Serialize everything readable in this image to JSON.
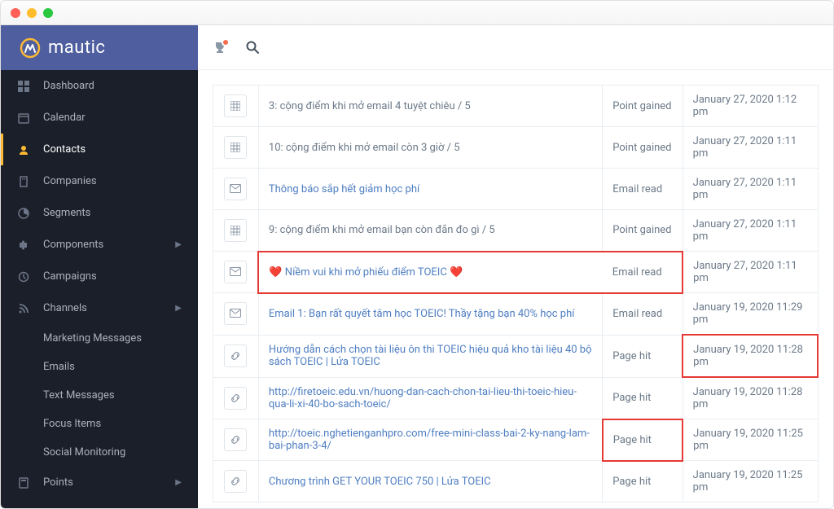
{
  "brand": {
    "name": "mautic"
  },
  "nav": {
    "items": [
      {
        "label": "Dashboard"
      },
      {
        "label": "Calendar"
      },
      {
        "label": "Contacts"
      },
      {
        "label": "Companies"
      },
      {
        "label": "Segments"
      },
      {
        "label": "Components"
      },
      {
        "label": "Campaigns"
      },
      {
        "label": "Channels"
      },
      {
        "label": "Points"
      }
    ],
    "channels_sub": [
      {
        "label": "Marketing Messages"
      },
      {
        "label": "Emails"
      },
      {
        "label": "Text Messages"
      },
      {
        "label": "Focus Items"
      },
      {
        "label": "Social Monitoring"
      }
    ]
  },
  "rows": [
    {
      "desc": "3: cộng điểm khi mở email 4 tuyệt chiêu / 5",
      "type": "Point gained",
      "date": "January 27, 2020 1:12 pm",
      "icon": "grid",
      "link": false
    },
    {
      "desc": "10: cộng điểm khi mở email còn 3 giờ / 5",
      "type": "Point gained",
      "date": "January 27, 2020 1:11 pm",
      "icon": "grid",
      "link": false
    },
    {
      "desc": "Thông báo sắp hết giảm học phí",
      "type": "Email read",
      "date": "January 27, 2020 1:11 pm",
      "icon": "mail",
      "link": true
    },
    {
      "desc": "9: cộng điểm khi mở email bạn còn đắn đo gì / 5",
      "type": "Point gained",
      "date": "January 27, 2020 1:11 pm",
      "icon": "grid",
      "link": false
    },
    {
      "desc": "❤️ Niềm vui khi mở phiếu điểm TOEIC ❤️",
      "type": "Email read",
      "date": "January 27, 2020 1:11 pm",
      "icon": "mail",
      "link": true
    },
    {
      "desc": "Email 1: Bạn rất quyết tâm học TOEIC! Thầy tặng bạn 40% học phí",
      "type": "Email read",
      "date": "January 19, 2020 11:29 pm",
      "icon": "mail",
      "link": true
    },
    {
      "desc": "Hướng dẫn cách chọn tài liệu ôn thi TOEIC hiệu quả kho tài liệu 40 bộ sách TOEIC | Lửa TOEIC",
      "type": "Page hit",
      "date": "January 19, 2020 11:28 pm",
      "icon": "link",
      "link": true
    },
    {
      "desc": "http://firetoeic.edu.vn/huong-dan-cach-chon-tai-lieu-thi-toeic-hieu-qua-li-xi-40-bo-sach-toeic/",
      "type": "Page hit",
      "date": "January 19, 2020 11:28 pm",
      "icon": "link",
      "link": true
    },
    {
      "desc": "http://toeic.nghetienganhpro.com/free-mini-class-bai-2-ky-nang-lam-bai-phan-3-4/",
      "type": "Page hit",
      "date": "January 19, 2020 11:25 pm",
      "icon": "link",
      "link": true
    },
    {
      "desc": "Chương trình GET YOUR TOEIC 750 | Lửa TOEIC",
      "type": "Page hit",
      "date": "January 19, 2020 11:25 pm",
      "icon": "link",
      "link": true
    }
  ]
}
